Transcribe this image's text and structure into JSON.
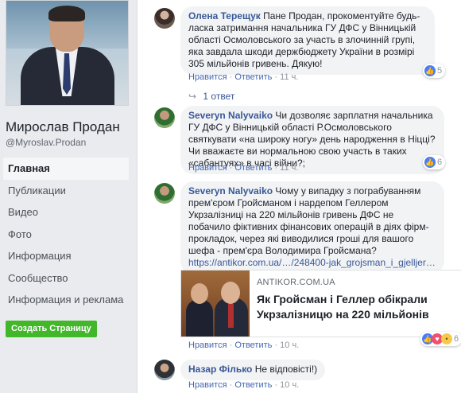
{
  "profile": {
    "name": "Мирослав Продан",
    "handle": "@Myroslav.Prodan"
  },
  "nav": {
    "items": [
      {
        "label": "Главная"
      },
      {
        "label": "Публикации"
      },
      {
        "label": "Видео"
      },
      {
        "label": "Фото"
      },
      {
        "label": "Информация"
      },
      {
        "label": "Сообщество"
      },
      {
        "label": "Информация и реклама"
      }
    ],
    "create_button": "Создать Страницу"
  },
  "comments": [
    {
      "author": "Олена Терещук",
      "text": "Пане Продан, прокоментуйте будь-ласка затримання начальника ГУ ДФС у Вінницькій області Осмоловського за участь в злочинній групі, яка завдала шкоди держбюджету України в розмірі 305 мільйонів гривень. Дякую!",
      "like": "Нравится",
      "reply": "Ответить",
      "time": "11 ч.",
      "reactions": "5",
      "replies": "1 ответ"
    },
    {
      "author": "Severyn Nalyvaiko",
      "text": "Чи дозволяє зарплатня начальника ГУ ДФС у Вінницькій області Р.Осмоловського святкувати «на широку ногу» день народження в Ніцці? Чи вважаєте ви нормальною свою участь в таких «сабантуях» в часі війни?;",
      "like": "Нравится",
      "reply": "Ответить",
      "time": "11 ч.",
      "reactions": "6"
    },
    {
      "author": "Severyn Nalyvaiko",
      "text": "Чому у випадку з пограбуванням прем'єром Гройсманом і нардепом Геллером Укрзалізниці на 220 мільйонів гривень ДФС не побачило фіктивних фінансових операцій в діях фірм-прокладок, через які виводилися гроші для вашого шефа - прем'єра Володимира Гройсмана?",
      "link": "https://antikor.com.ua/…/248400-jak_grojsman_i_gjelljer…",
      "preview_domain": "ANTIKOR.COM.UA",
      "preview_title": "Як Гройсман і Геллер обікрали Укрзалізницю на 220 мільйонів",
      "like": "Нравится",
      "reply": "Ответить",
      "time": "10 ч.",
      "reactions": "6"
    },
    {
      "author": "Назар Філько",
      "text": "Не відповісті!)",
      "like": "Нравится",
      "reply": "Ответить",
      "time": "10 ч."
    }
  ],
  "separator": "·",
  "icons": {
    "like": "thumbs-up-icon",
    "love": "heart-icon",
    "wow": "wow-icon",
    "reply": "reply-arrow-icon"
  },
  "colors": {
    "link": "#385898",
    "create_button": "#42b72a",
    "like_icon": "#4a7df7"
  }
}
